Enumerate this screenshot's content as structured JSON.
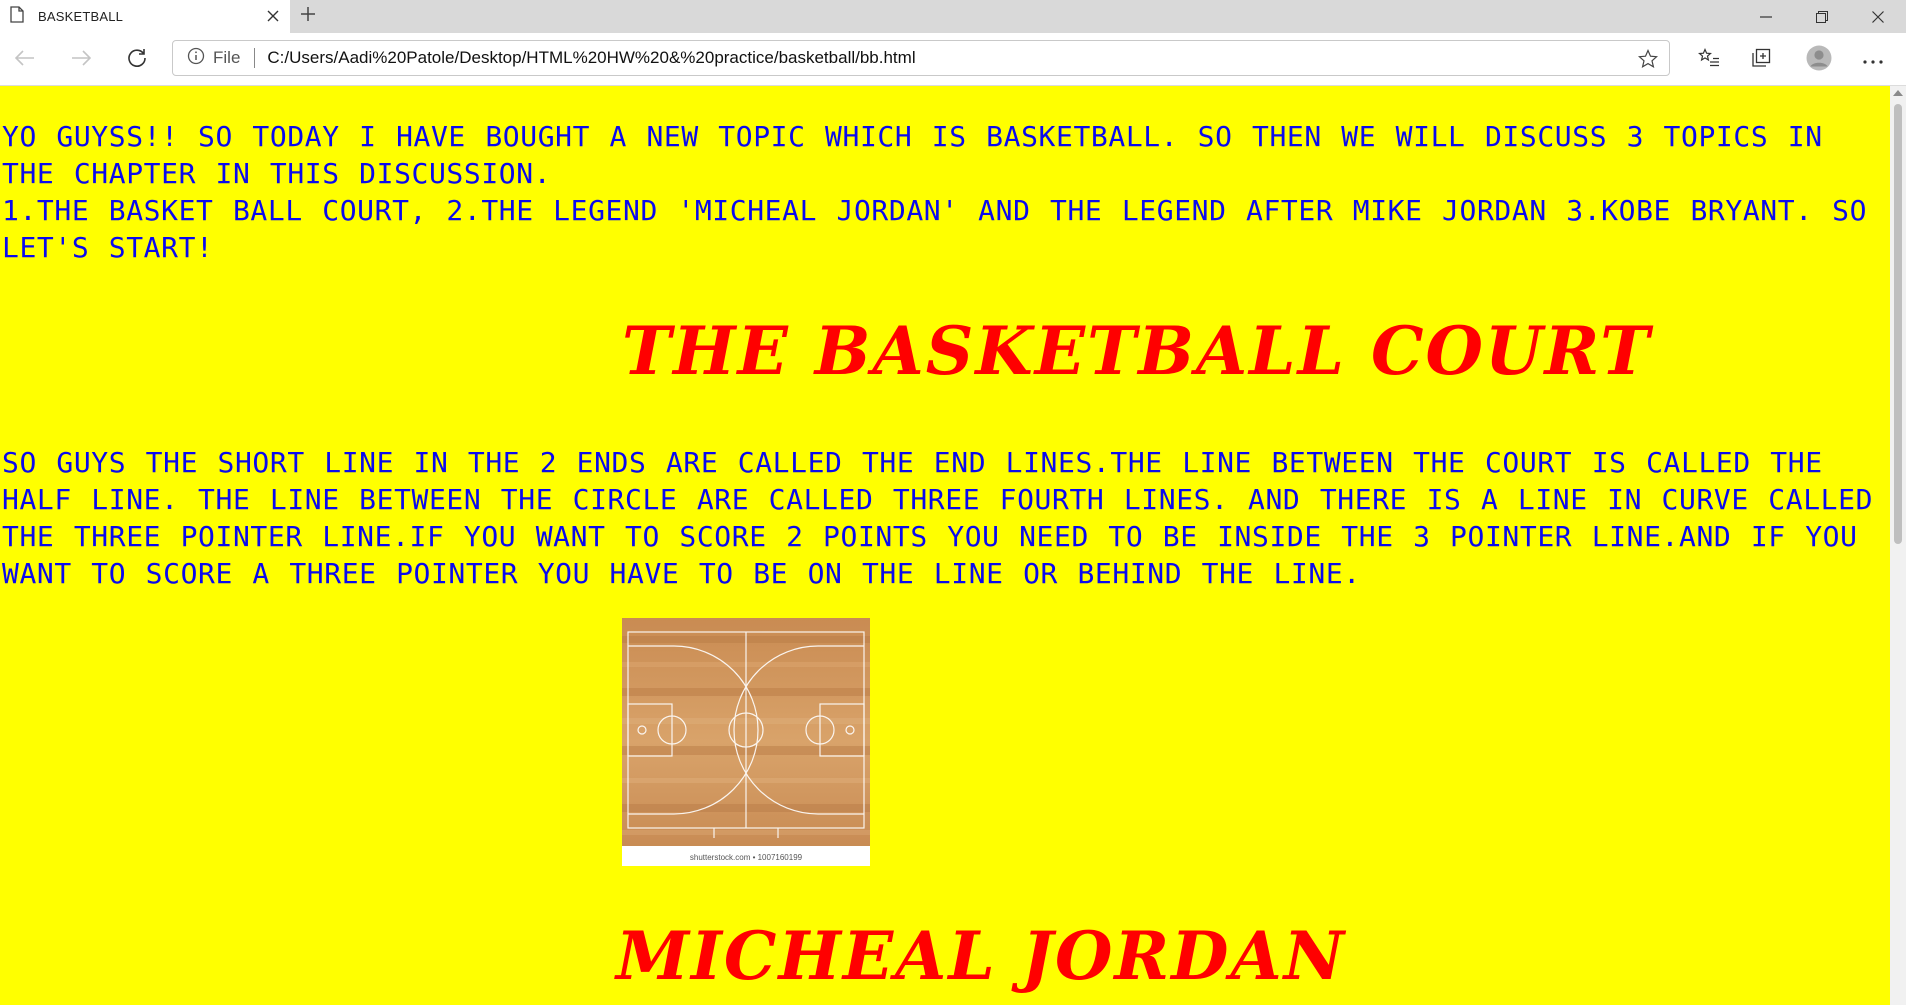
{
  "tab": {
    "title": "BASKETBALL"
  },
  "addressbar": {
    "scheme_label": "File",
    "url": "C:/Users/Aadi%20Patole/Desktop/HTML%20HW%20&%20practice/basketball/bb.html"
  },
  "icons": {
    "tab": "document-icon",
    "close": "close-icon",
    "new_tab": "plus-icon",
    "back": "back-arrow-icon",
    "forward": "forward-arrow-icon",
    "refresh": "refresh-icon",
    "info": "info-icon",
    "favorite": "star-icon",
    "favorites": "favorites-icon",
    "collections": "collections-icon",
    "profile": "profile-icon",
    "more": "more-icon"
  },
  "colors": {
    "page_background": "#ffff00",
    "body_text": "#0a0aee",
    "heading": "#ff0000"
  },
  "content": {
    "intro_line_1": "YO GUYSS!! SO TODAY I HAVE BOUGHT A NEW TOPIC WHICH IS BASKETBALL. SO THEN WE WILL DISCUSS 3 TOPICS IN THE CHAPTER IN THIS DISCUSSION.",
    "intro_line_2": "1.THE BASKET BALL COURT, 2.THE LEGEND 'MICHEAL JORDAN' AND THE LEGEND AFTER MIKE JORDAN 3.KOBE BRYANT. SO LET'S START!",
    "heading_court": "THE BASKETBALL COURT",
    "court_text": "SO GUYS THE SHORT LINE IN THE 2 ENDS ARE CALLED THE END LINES.THE LINE BETWEEN THE COURT IS CALLED THE HALF LINE. THE LINE BETWEEN THE CIRCLE ARE CALLED THREE FOURTH LINES. AND THERE IS A LINE IN CURVE CALLED THE THREE POINTER LINE.IF YOU WANT TO SCORE 2 POINTS YOU NEED TO BE INSIDE THE 3 POINTER LINE.AND IF YOU WANT TO SCORE A THREE POINTER YOU HAVE TO BE ON THE LINE OR BEHIND THE LINE.",
    "court_image_caption": "shutterstock.com • 1007160199",
    "heading_jordan": "MICHEAL JORDAN"
  }
}
